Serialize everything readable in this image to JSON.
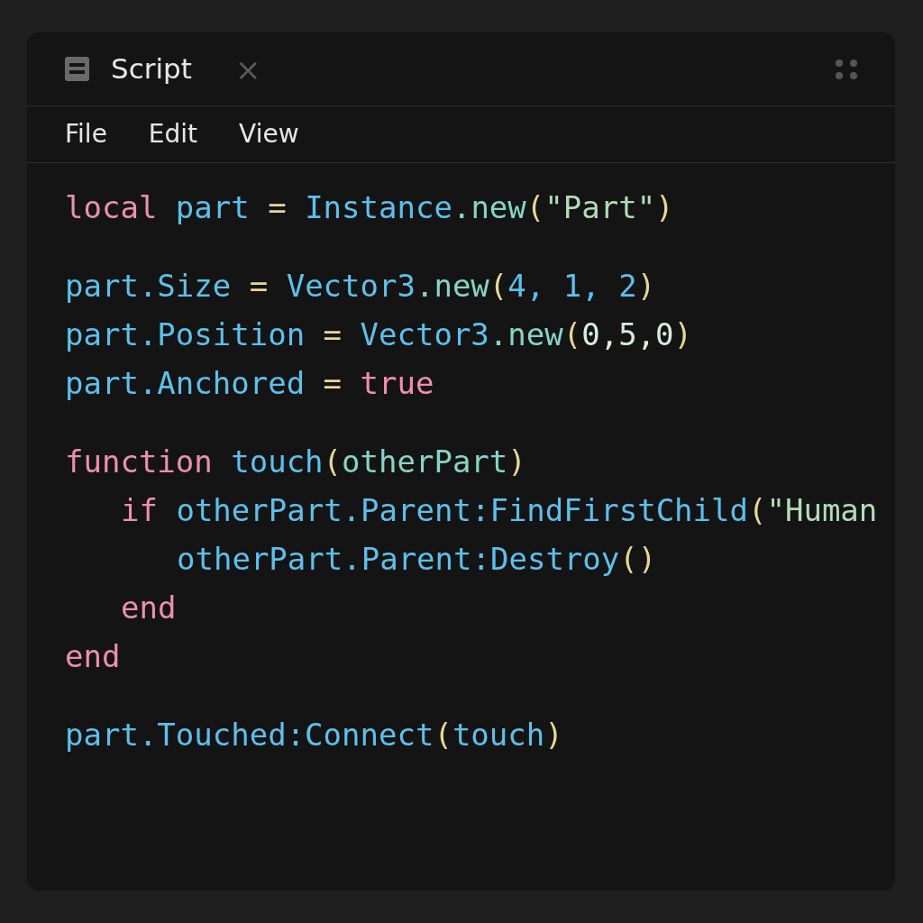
{
  "window": {
    "title": "Script",
    "close": "×"
  },
  "menu": [
    {
      "label": "File"
    },
    {
      "label": "Edit"
    },
    {
      "label": "View"
    }
  ],
  "code": [
    {
      "lines": [
        {
          "tokens": [
            {
              "kind": "kw",
              "text": "local"
            },
            {
              "kind": "id",
              "text": " part "
            },
            {
              "kind": "op",
              "text": "="
            },
            {
              "kind": "id",
              "text": " Instance"
            },
            {
              "kind": "fn",
              "text": ".new"
            },
            {
              "kind": "punct",
              "text": "("
            },
            {
              "kind": "str",
              "text": "\"Part\""
            },
            {
              "kind": "punct",
              "text": ")"
            }
          ]
        }
      ]
    },
    {
      "lines": [
        {
          "tokens": [
            {
              "kind": "id",
              "text": "part.Size "
            },
            {
              "kind": "op",
              "text": "="
            },
            {
              "kind": "id",
              "text": " Vector3"
            },
            {
              "kind": "fn",
              "text": ".new"
            },
            {
              "kind": "punct",
              "text": "("
            },
            {
              "kind": "id",
              "text": "4, 1, 2"
            },
            {
              "kind": "punct",
              "text": ")"
            }
          ]
        },
        {
          "tokens": [
            {
              "kind": "id",
              "text": "part.Position "
            },
            {
              "kind": "op",
              "text": "="
            },
            {
              "kind": "id",
              "text": " Vector3"
            },
            {
              "kind": "fn",
              "text": ".new"
            },
            {
              "kind": "punct",
              "text": "("
            },
            {
              "kind": "num",
              "text": "0,5,0"
            },
            {
              "kind": "punct",
              "text": ")"
            }
          ]
        },
        {
          "tokens": [
            {
              "kind": "id",
              "text": "part.Anchored "
            },
            {
              "kind": "op",
              "text": "="
            },
            {
              "kind": "kw",
              "text": " true"
            }
          ]
        }
      ]
    },
    {
      "lines": [
        {
          "tokens": [
            {
              "kind": "kw",
              "text": "function"
            },
            {
              "kind": "id",
              "text": " touch"
            },
            {
              "kind": "punct",
              "text": "("
            },
            {
              "kind": "fn",
              "text": "otherPart"
            },
            {
              "kind": "punct",
              "text": ")"
            }
          ],
          "children": [
            {
              "tokens": [
                {
                  "kind": "kw",
                  "text": "if"
                },
                {
                  "kind": "id",
                  "text": " otherPart.Parent:FindFirstChild"
                },
                {
                  "kind": "punct",
                  "text": "("
                },
                {
                  "kind": "str",
                  "text": "\"Human"
                }
              ],
              "children": [
                {
                  "tokens": [
                    {
                      "kind": "id",
                      "text": "otherPart.Parent:Destroy"
                    },
                    {
                      "kind": "punct",
                      "text": "()"
                    }
                  ]
                }
              ]
            },
            {
              "tokens": [
                {
                  "kind": "kw",
                  "text": "end"
                }
              ]
            }
          ]
        },
        {
          "tokens": [
            {
              "kind": "kw",
              "text": "end"
            }
          ]
        }
      ]
    },
    {
      "lines": [
        {
          "tokens": [
            {
              "kind": "id",
              "text": "part.Touched:Connect"
            },
            {
              "kind": "punct",
              "text": "("
            },
            {
              "kind": "id",
              "text": "touch"
            },
            {
              "kind": "punct",
              "text": ")"
            }
          ]
        }
      ]
    }
  ]
}
